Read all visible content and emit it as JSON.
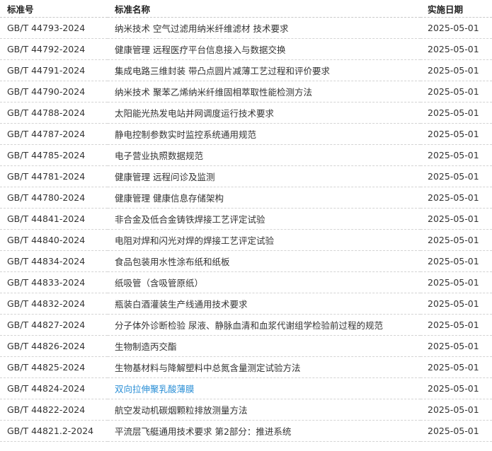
{
  "table": {
    "headers": {
      "code": "标准号",
      "name": "标准名称",
      "date": "实施日期"
    },
    "rows": [
      {
        "code": "GB/T 44793-2024",
        "name": "纳米技术 空气过滤用纳米纤维滤材 技术要求",
        "date": "2025-05-01"
      },
      {
        "code": "GB/T 44792-2024",
        "name": "健康管理 远程医疗平台信息接入与数据交换",
        "date": "2025-05-01"
      },
      {
        "code": "GB/T 44791-2024",
        "name": "集成电路三维封装 带凸点圆片减薄工艺过程和评价要求",
        "date": "2025-05-01"
      },
      {
        "code": "GB/T 44790-2024",
        "name": "纳米技术 聚苯乙烯纳米纤维固相萃取性能检测方法",
        "date": "2025-05-01"
      },
      {
        "code": "GB/T 44788-2024",
        "name": "太阳能光热发电站并网调度运行技术要求",
        "date": "2025-05-01"
      },
      {
        "code": "GB/T 44787-2024",
        "name": "静电控制参数实时监控系统通用规范",
        "date": "2025-05-01"
      },
      {
        "code": "GB/T 44785-2024",
        "name": "电子营业执照数据规范",
        "date": "2025-05-01"
      },
      {
        "code": "GB/T 44781-2024",
        "name": "健康管理 远程问诊及监测",
        "date": "2025-05-01"
      },
      {
        "code": "GB/T 44780-2024",
        "name": "健康管理 健康信息存储架构",
        "date": "2025-05-01"
      },
      {
        "code": "GB/T 44841-2024",
        "name": "非合金及低合金铸铁焊接工艺评定试验",
        "date": "2025-05-01"
      },
      {
        "code": "GB/T 44840-2024",
        "name": "电阻对焊和闪光对焊的焊接工艺评定试验",
        "date": "2025-05-01"
      },
      {
        "code": "GB/T 44834-2024",
        "name": "食品包装用水性涂布纸和纸板",
        "date": "2025-05-01"
      },
      {
        "code": "GB/T 44833-2024",
        "name": "纸吸管（含吸管原纸）",
        "date": "2025-05-01"
      },
      {
        "code": "GB/T 44832-2024",
        "name": "瓶装白酒灌装生产线通用技术要求",
        "date": "2025-05-01"
      },
      {
        "code": "GB/T 44827-2024",
        "name": "分子体外诊断检验 尿液、静脉血清和血浆代谢组学检验前过程的规范",
        "date": "2025-05-01"
      },
      {
        "code": "GB/T 44826-2024",
        "name": "生物制造丙交酯",
        "date": "2025-05-01"
      },
      {
        "code": "GB/T 44825-2024",
        "name": "生物基材料与降解塑料中总氮含量测定试验方法",
        "date": "2025-05-01"
      },
      {
        "code": "GB/T 44824-2024",
        "name": "双向拉伸聚乳酸薄膜",
        "date": "2025-05-01",
        "hover": true
      },
      {
        "code": "GB/T 44822-2024",
        "name": "航空发动机碳烟颗粒排放测量方法",
        "date": "2025-05-01"
      },
      {
        "code": "GB/T 44821.2-2024",
        "name": "平流层飞艇通用技术要求 第2部分：推进系统",
        "date": "2025-05-01"
      }
    ]
  },
  "colors": {
    "text": "#333333",
    "link_hover": "#2b8fd6",
    "row_divider": "#d4d4d4"
  }
}
